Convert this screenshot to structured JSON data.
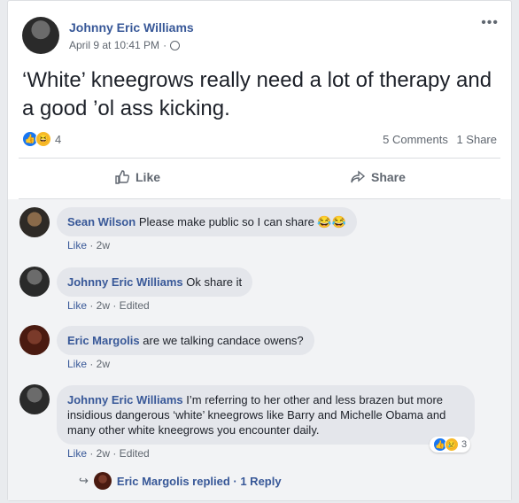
{
  "post": {
    "author": "Johnny Eric Williams",
    "timestamp": "April 9 at 10:41 PM",
    "dot": "·",
    "more": "•••",
    "text": "‘White’ kneegrows really need a lot of therapy and a good ’ol ass kicking.",
    "reaction_count": "4",
    "comments_count": "5 Comments",
    "shares_count": "1 Share",
    "like_label": "Like",
    "share_label": "Share"
  },
  "comments": [
    {
      "name": "Sean Wilson",
      "text": "Please make public so I can share 😂😂",
      "meta_like": "Like",
      "meta_rest": " · 2w"
    },
    {
      "name": "Johnny Eric Williams",
      "text": "Ok share it",
      "meta_like": "Like",
      "meta_rest": " · 2w · Edited"
    },
    {
      "name": "Eric Margolis",
      "text": "are we talking candace owens?",
      "meta_like": "Like",
      "meta_rest": " · 2w"
    },
    {
      "name": "Johnny Eric Williams",
      "text": "I’m referring to her other and less brazen but more insidious dangerous ‘white’ kneegrows like Barry and Michelle Obama and many other white kneegrows you encounter daily.",
      "meta_like": "Like",
      "meta_rest": " · 2w · Edited",
      "reaction_count": "3"
    }
  ],
  "reply_line": {
    "name": "Eric Margolis",
    "text": "Eric Margolis replied · 1 Reply"
  },
  "colors": {
    "link": "#385898",
    "secondary": "#606770",
    "like_blue": "#1877f2"
  }
}
